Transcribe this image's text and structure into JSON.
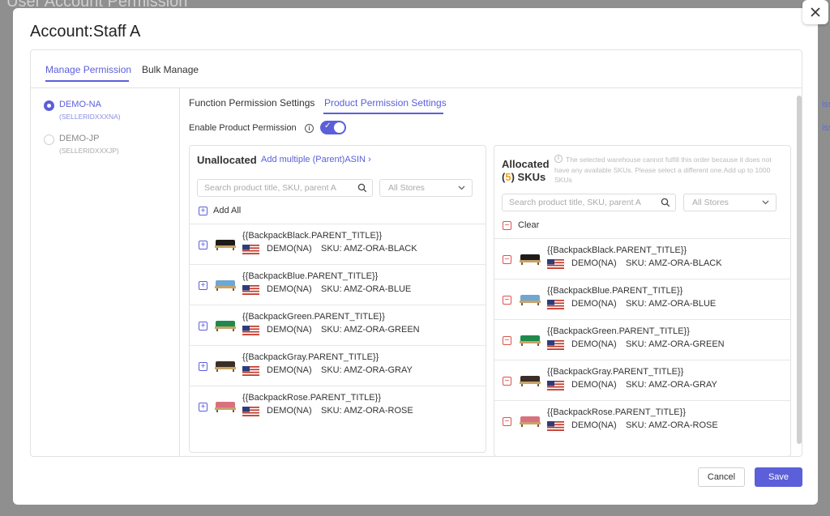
{
  "background": {
    "page_title": "User Account Permission",
    "links": [
      "ission",
      "ission"
    ]
  },
  "modal": {
    "title": "Account:Staff A",
    "top_tabs": [
      "Manage Permission",
      "Bulk Manage"
    ],
    "accounts": [
      {
        "name": "DEMO-NA",
        "id": "(SELLERIDXXXNA)",
        "selected": true
      },
      {
        "name": "DEMO-JP",
        "id": "(SELLERIDXXXJP)",
        "selected": false
      }
    ],
    "sub_tabs": [
      "Function Permission Settings",
      "Product Permission Settings"
    ],
    "enable_label": "Enable Product Permission",
    "enable_on": true,
    "unallocated": {
      "title": "Unallocated",
      "add_multiple": "Add multiple (Parent)ASIN",
      "search_placeholder": "Search product title, SKU, parent A",
      "store_select": "All Stores",
      "add_all": "Add All"
    },
    "allocated": {
      "title": "Allocated",
      "count_prefix": "(",
      "count": "5",
      "count_suffix": ") SKUs",
      "notice": "The selected warehouse cannot fulfill this order because it does not have any available SKUs. Please select a different one.Add up to 1000 SKUs",
      "search_placeholder": "Search product title, SKU, parent A",
      "store_select": "All Stores",
      "clear": "Clear"
    },
    "products": [
      {
        "title": "{{BackpackBlack.PARENT_TITLE}}",
        "store": "DEMO(NA)",
        "sku": "SKU: AMZ-ORA-BLACK",
        "color": "#1f1b18"
      },
      {
        "title": "{{BackpackBlue.PARENT_TITLE}}",
        "store": "DEMO(NA)",
        "sku": "SKU: AMZ-ORA-BLUE",
        "color": "#6ea7d3"
      },
      {
        "title": "{{BackpackGreen.PARENT_TITLE}}",
        "store": "DEMO(NA)",
        "sku": "SKU: AMZ-ORA-GREEN",
        "color": "#1f8a4c"
      },
      {
        "title": "{{BackpackGray.PARENT_TITLE}}",
        "store": "DEMO(NA)",
        "sku": "SKU: AMZ-ORA-GRAY",
        "color": "#3b2e24"
      },
      {
        "title": "{{BackpackRose.PARENT_TITLE}}",
        "store": "DEMO(NA)",
        "sku": "SKU: AMZ-ORA-ROSE",
        "color": "#d9707e"
      }
    ],
    "buttons": {
      "cancel": "Cancel",
      "save": "Save"
    },
    "colors": {
      "accent": "#5b5fd9",
      "danger": "#d9534f",
      "count": "#f0a020"
    }
  }
}
